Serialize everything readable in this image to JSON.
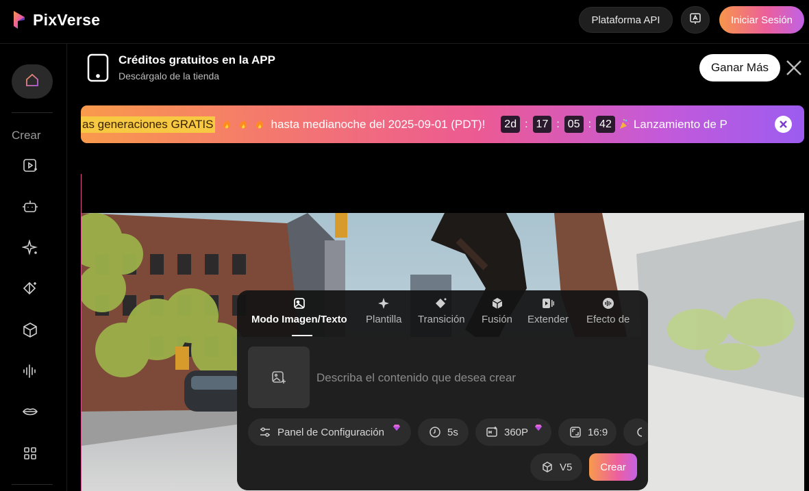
{
  "header": {
    "brand": "PixVerse",
    "api_label": "Plataforma API",
    "login_label": "Iniciar Sesión"
  },
  "sidebar": {
    "section_label": "Crear",
    "icons": [
      "home-icon",
      "play-video-icon",
      "robot-icon",
      "sparkle-icon",
      "transition-icon",
      "cube-icon",
      "audio-wave-icon",
      "lips-icon",
      "grid-icon"
    ]
  },
  "promo": {
    "title": "Créditos gratuitos en la APP",
    "subtitle": "Descárgalo de la tienda",
    "earn_label": "Ganar Más"
  },
  "banner": {
    "highlight": "as generaciones GRATIS",
    "text": "hasta medianoche del 2025-09-01 (PDT)!",
    "countdown": [
      "2d",
      "17",
      "05",
      "42"
    ],
    "trailing": "Lanzamiento de P"
  },
  "panel": {
    "tabs": [
      {
        "label": "Modo Imagen/Texto",
        "icon": "image-icon"
      },
      {
        "label": "Plantilla",
        "icon": "sparkle-icon"
      },
      {
        "label": "Transición",
        "icon": "transition-icon"
      },
      {
        "label": "Fusión",
        "icon": "cube-icon"
      },
      {
        "label": "Extender",
        "icon": "extend-icon"
      },
      {
        "label": "Efecto de",
        "icon": "audio-icon"
      }
    ],
    "prompt_placeholder": "Describa el contenido que desea crear",
    "chips": {
      "config": "Panel de Configuración",
      "duration": "5s",
      "quality": "360P",
      "ratio": "16:9",
      "model": "V5"
    },
    "create_label": "Crear"
  },
  "colors": {
    "accent_gradient": [
      "#f7964a",
      "#ec5f9a",
      "#c062e6"
    ],
    "highlight": "#f7c842"
  }
}
